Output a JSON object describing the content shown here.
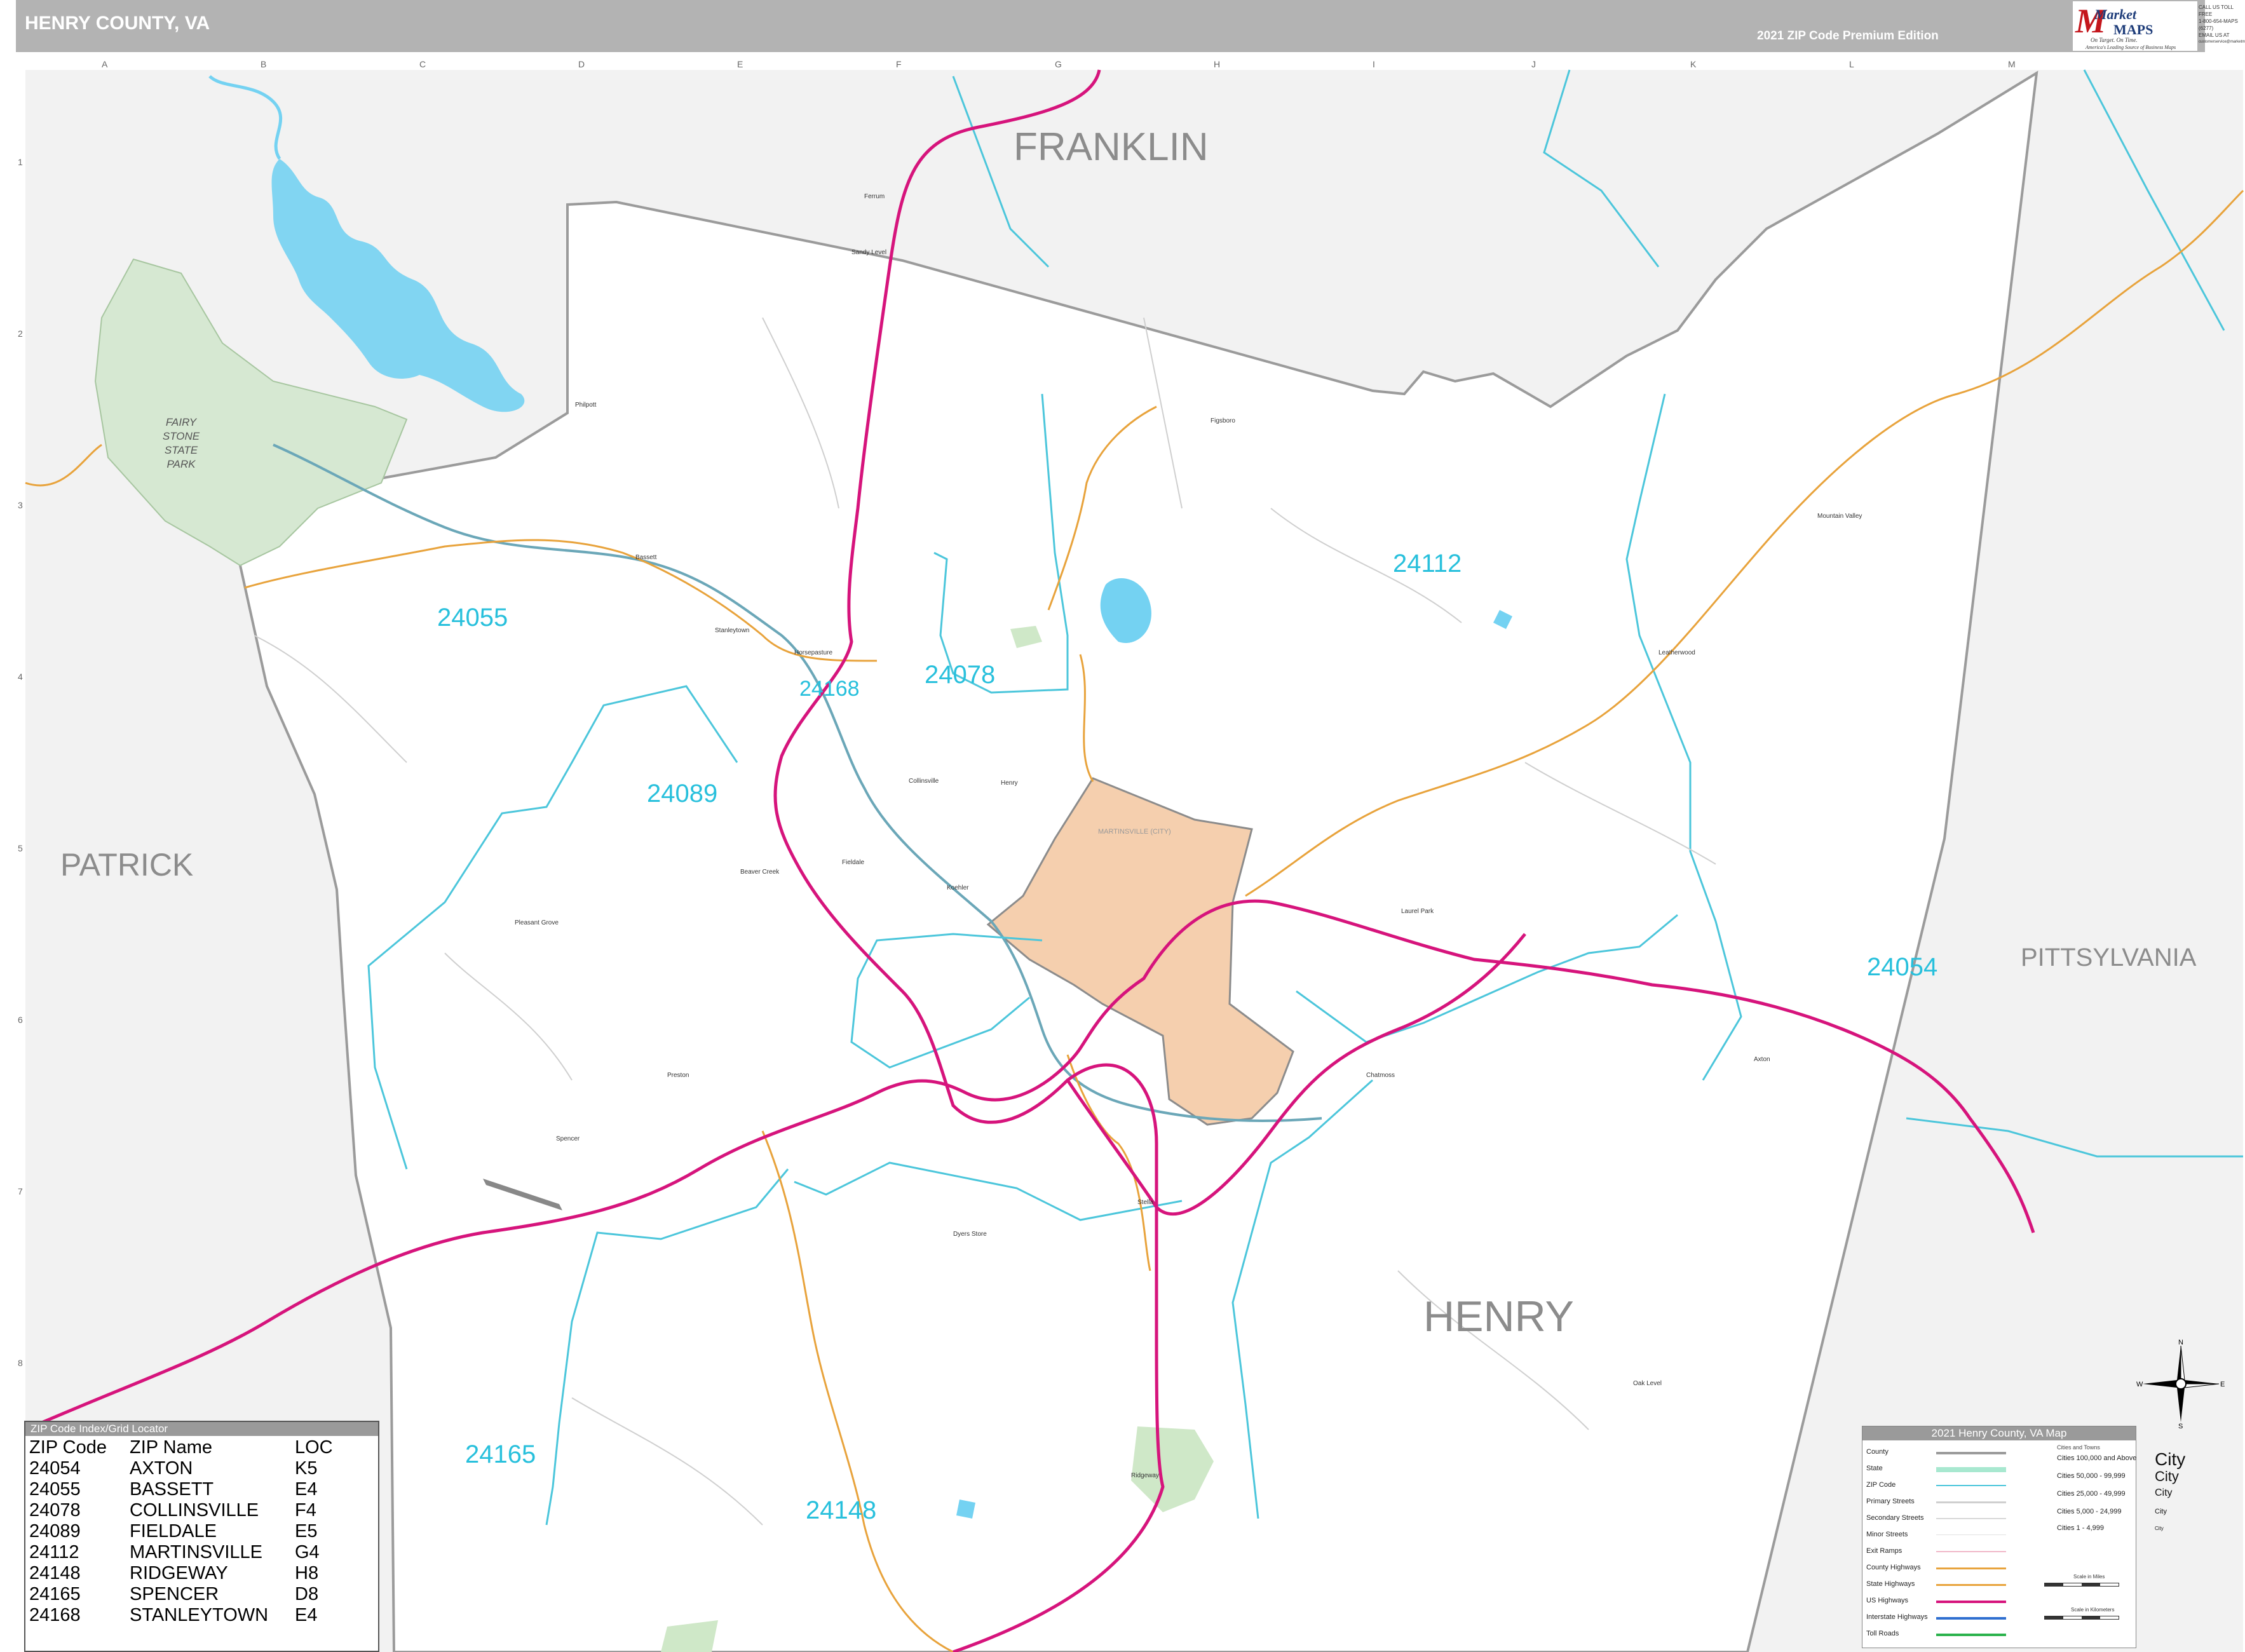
{
  "header": {
    "title": "HENRY COUNTY, VA",
    "edition": "2021 ZIP Code Premium Edition"
  },
  "logo": {
    "market": "Market",
    "maps": "MAPS",
    "slogan": "On Target.  On Time.",
    "subtitle": "America's Leading Source of Business Maps",
    "contact": [
      "CALL US TOLL FREE",
      "1-800-654-MAPS (6277)",
      "EMAIL US AT",
      "customerservice@marketmaps.com"
    ]
  },
  "grid": {
    "columns": [
      "A",
      "B",
      "C",
      "D",
      "E",
      "F",
      "G",
      "H",
      "I",
      "J",
      "K",
      "L",
      "M"
    ],
    "rows": [
      "1",
      "2",
      "3",
      "4",
      "5",
      "6",
      "7",
      "8"
    ]
  },
  "map_labels": {
    "counties": {
      "franklin": "FRANKLIN",
      "patrick": "PATRICK",
      "pittsylvania": "PITTSYLVANIA",
      "henry": "HENRY"
    },
    "park": [
      "FAIRY",
      "STONE",
      "STATE",
      "PARK"
    ],
    "city": "MARTINSVILLE (CITY)",
    "zip_codes": [
      {
        "code": "24055",
        "name": "bassett"
      },
      {
        "code": "24168",
        "name": "stanleytown"
      },
      {
        "code": "24078",
        "name": "collinsville"
      },
      {
        "code": "24089",
        "name": "fieldale"
      },
      {
        "code": "24112",
        "name": "martinsville"
      },
      {
        "code": "24054",
        "name": "axton"
      },
      {
        "code": "24165",
        "name": "spencer"
      },
      {
        "code": "24148",
        "name": "ridgeway"
      }
    ],
    "places": [
      "Ferrum",
      "Philpott",
      "Bassett",
      "Stanleytown",
      "Collinsville",
      "Fieldale",
      "Koehler",
      "Horsepasture",
      "Spencer",
      "Ridgeway",
      "Chatmoss",
      "Axton",
      "Laurel Park",
      "Leatherwood",
      "Mountain Valley",
      "Sandy Level",
      "Henry",
      "Figsboro",
      "Preston",
      "Oak Level",
      "Dyers Store",
      "Stella",
      "Pleasant Grove",
      "Beaver Creek"
    ]
  },
  "zip_index": {
    "title": "ZIP Code Index/Grid Locator",
    "columns": [
      "ZIP Code",
      "ZIP Name",
      "LOC"
    ],
    "rows": [
      [
        "24054",
        "AXTON",
        "K5"
      ],
      [
        "24055",
        "BASSETT",
        "E4"
      ],
      [
        "24078",
        "COLLINSVILLE",
        "F4"
      ],
      [
        "24089",
        "FIELDALE",
        "E5"
      ],
      [
        "24112",
        "MARTINSVILLE",
        "G4"
      ],
      [
        "24148",
        "RIDGEWAY",
        "H8"
      ],
      [
        "24165",
        "SPENCER",
        "D8"
      ],
      [
        "24168",
        "STANLEYTOWN",
        "E4"
      ]
    ]
  },
  "legend": {
    "title": "2021 Henry County, VA Map",
    "items": [
      "County",
      "State",
      "ZIP Code",
      "Primary Streets",
      "Secondary Streets",
      "Minor Streets",
      "Exit Ramps",
      "County Highways",
      "State Highways",
      "US Highways",
      "Interstate Highways",
      "Toll Roads"
    ],
    "cities_header": "Cities and Towns",
    "city_classes": [
      {
        "range": "Cities 100,000 and Above",
        "label": "City"
      },
      {
        "range": "Cities 50,000 - 99,999",
        "label": "City"
      },
      {
        "range": "Cities 25,000 - 49,999",
        "label": "City"
      },
      {
        "range": "Cities 5,000 - 24,999",
        "label": "City"
      },
      {
        "range": "Cities 1 - 4,999",
        "label": "City"
      }
    ],
    "scale_miles": "Scale in Miles",
    "scale_km": "Scale in Kilometers"
  },
  "compass": {
    "n": "N",
    "s": "S",
    "e": "E",
    "w": "W"
  },
  "colors": {
    "county_fill": "#ffffff",
    "outside_fill": "#f2f2f2",
    "zip_boundary": "#4cc6db",
    "water": "#74d2f2",
    "park": "#d6e8d2",
    "city_fill": "#f5cfae",
    "us_highway": "#d6147c",
    "county_highway": "#e8a33c",
    "zip_label": "#28c0dc"
  }
}
